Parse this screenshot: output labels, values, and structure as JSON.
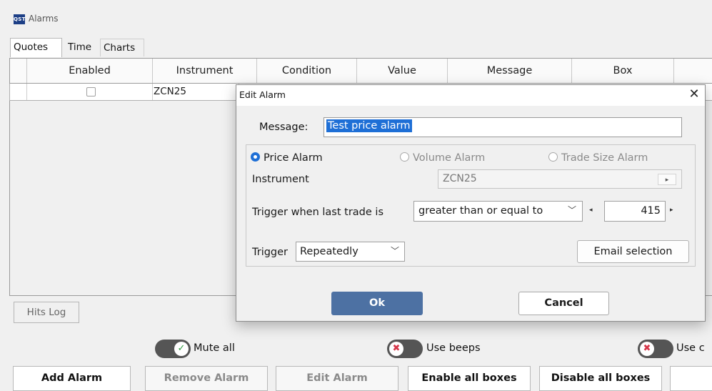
{
  "window": {
    "logo_text": "QST",
    "title": "Alarms"
  },
  "tabs": [
    {
      "label": "Quotes"
    },
    {
      "label": "Time"
    },
    {
      "label": "Charts"
    }
  ],
  "grid": {
    "columns": [
      "Enabled",
      "Instrument",
      "Condition",
      "Value",
      "Message",
      "Box"
    ],
    "rows": [
      {
        "enabled": false,
        "instrument": "ZCN25"
      }
    ]
  },
  "hits_log_label": "Hits Log",
  "toggles": {
    "mute_all": {
      "label": "Mute all",
      "on": true
    },
    "use_beeps": {
      "label": "Use beeps",
      "on": false
    },
    "use_c": {
      "label": "Use c",
      "on": false
    }
  },
  "buttons": {
    "add_alarm": "Add Alarm",
    "remove_alarm": "Remove Alarm",
    "edit_alarm": "Edit Alarm",
    "enable_all": "Enable all boxes",
    "disable_all": "Disable all boxes"
  },
  "dialog": {
    "title": "Edit Alarm",
    "close_glyph": "✕",
    "message_label": "Message:",
    "message_value": "Test price alarm",
    "alarm_types": [
      {
        "label": "Price Alarm",
        "selected": true,
        "enabled": true
      },
      {
        "label": "Volume Alarm",
        "selected": false,
        "enabled": false
      },
      {
        "label": "Trade Size Alarm",
        "selected": false,
        "enabled": false
      }
    ],
    "instrument_label": "Instrument",
    "instrument_value": "ZCN25",
    "trigger_label": "Trigger when last trade is",
    "condition_value": "greater than or equal to",
    "value": "415",
    "trigger_mode_label": "Trigger",
    "trigger_mode_value": "Repeatedly",
    "email_button": "Email selection",
    "ok_button": "Ok",
    "cancel_button": "Cancel"
  },
  "colors": {
    "accent": "#1e6fd6",
    "ok_button": "#4d71a3",
    "toggle_track": "#555555",
    "toggle_off_icon": "#d6364a",
    "toggle_on_icon": "#2e9b3e"
  }
}
